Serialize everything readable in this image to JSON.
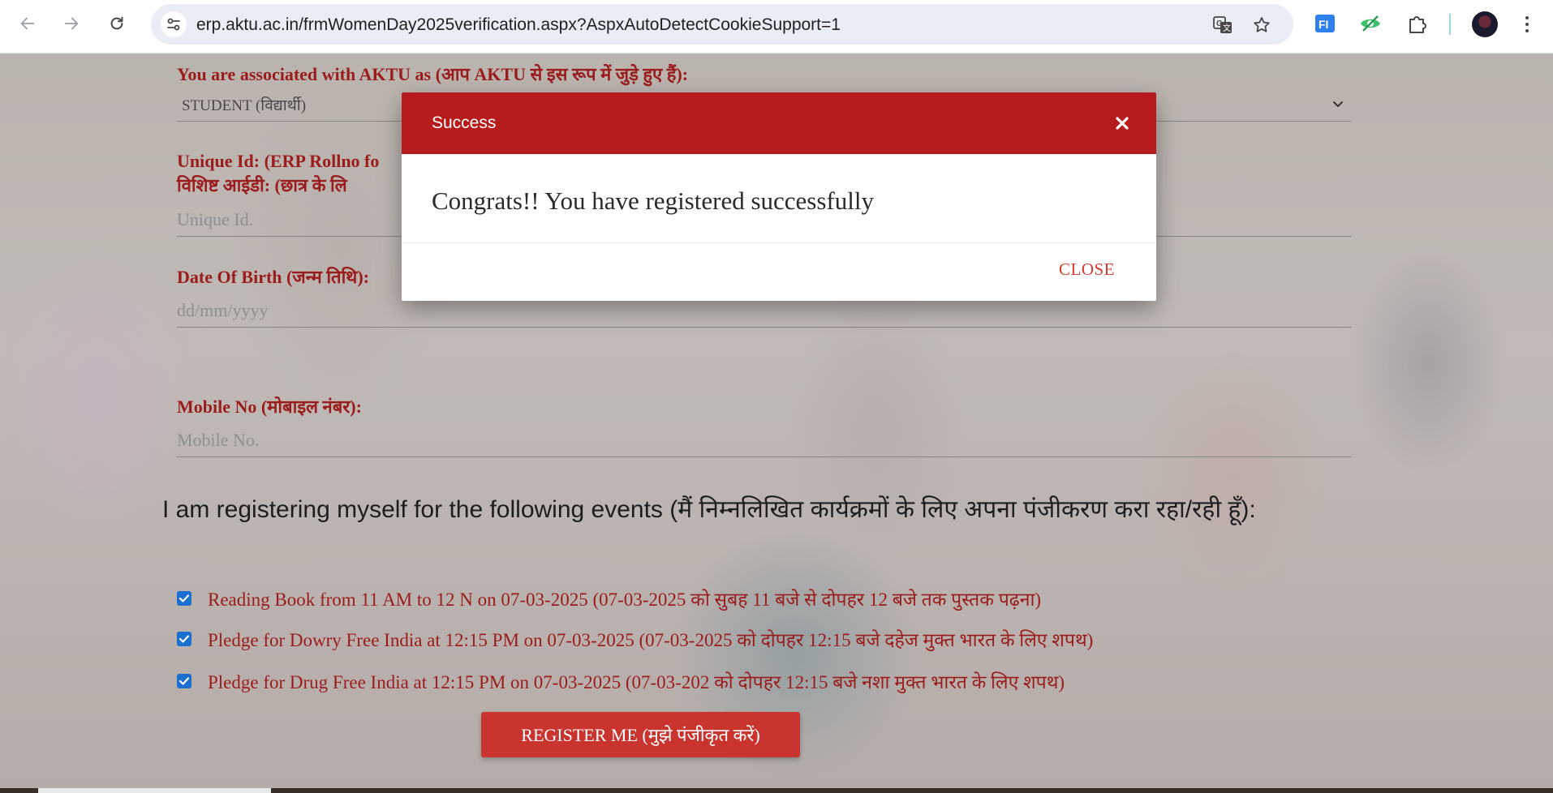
{
  "browser": {
    "url": "erp.aktu.ac.in/frmWomenDay2025verification.aspx?AspxAutoDetectCookieSupport=1"
  },
  "form": {
    "associated_label": "You are associated with AKTU as (आप AKTU से इस रूप में जुड़े हुए हैं):",
    "associated_value": "STUDENT (विद्यार्थी)",
    "unique_id_label_line1": "Unique Id: (ERP Rollno fo",
    "unique_id_label_line2": "विशिष्ट आईडी: (छात्र के लि",
    "unique_id_placeholder": "Unique Id.",
    "dob_label": "Date Of Birth (जन्म तिथि):",
    "dob_placeholder": "dd/mm/yyyy",
    "mobile_label": "Mobile No (मोबाइल नंबर):",
    "mobile_placeholder": "Mobile No."
  },
  "events": {
    "heading": "I am registering myself for the following events (मैं निम्नलिखित कार्यक्रमों के लिए अपना पंजीकरण करा रहा/रही हूँ):",
    "items": [
      {
        "label": "Reading Book from 11 AM to 12 N on 07-03-2025 (07-03-2025 को सुबह 11 बजे से दोपहर 12 बजे तक पुस्तक पढ़ना)",
        "checked": true
      },
      {
        "label": "Pledge for Dowry Free India at 12:15 PM on 07-03-2025 (07-03-2025 को दोपहर 12:15 बजे दहेज मुक्त भारत के लिए शपथ)",
        "checked": true
      },
      {
        "label": "Pledge for Drug Free India at 12:15 PM on 07-03-2025 (07-03-202 को दोपहर 12:15 बजे नशा मुक्त भारत के लिए शपथ)",
        "checked": true
      }
    ],
    "register_button": "REGISTER ME (मुझे पंजीकृत करें)"
  },
  "modal": {
    "title": "Success",
    "message": "Congrats!! You have registered successfully",
    "close_button": "CLOSE",
    "close_icon": "×"
  },
  "colors": {
    "modal_header": "#b71c1c",
    "label_red": "#9b1c1c",
    "button_red": "#c9342f",
    "checkbox_blue": "#1a6fd1"
  },
  "icons": [
    "back-arrow-icon",
    "forward-arrow-icon",
    "reload-icon",
    "site-info-icon",
    "translate-icon",
    "bookmark-star-icon",
    "extension-fi-icon",
    "extension-eye-icon",
    "extensions-puzzle-icon",
    "profile-avatar",
    "menu-kebab-icon",
    "close-icon",
    "chevron-down-icon",
    "checkmark-icon"
  ]
}
